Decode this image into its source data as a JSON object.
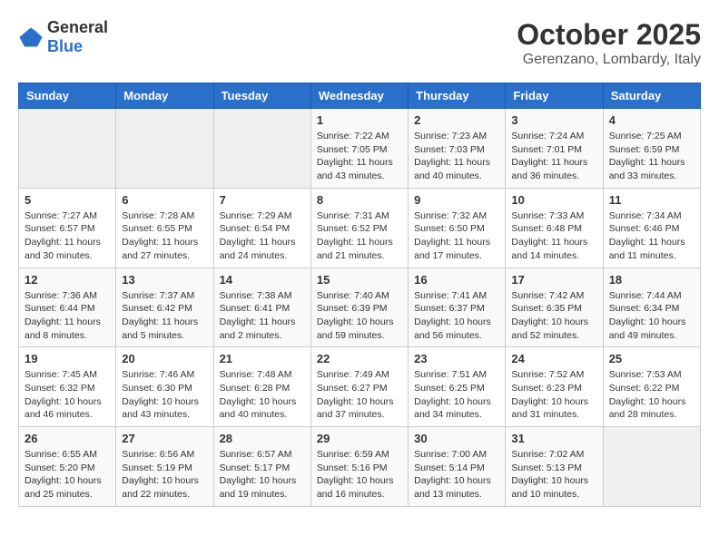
{
  "logo": {
    "general": "General",
    "blue": "Blue"
  },
  "header": {
    "month": "October 2025",
    "location": "Gerenzano, Lombardy, Italy"
  },
  "weekdays": [
    "Sunday",
    "Monday",
    "Tuesday",
    "Wednesday",
    "Thursday",
    "Friday",
    "Saturday"
  ],
  "weeks": [
    [
      {
        "day": "",
        "info": ""
      },
      {
        "day": "",
        "info": ""
      },
      {
        "day": "",
        "info": ""
      },
      {
        "day": "1",
        "info": "Sunrise: 7:22 AM\nSunset: 7:05 PM\nDaylight: 11 hours and 43 minutes."
      },
      {
        "day": "2",
        "info": "Sunrise: 7:23 AM\nSunset: 7:03 PM\nDaylight: 11 hours and 40 minutes."
      },
      {
        "day": "3",
        "info": "Sunrise: 7:24 AM\nSunset: 7:01 PM\nDaylight: 11 hours and 36 minutes."
      },
      {
        "day": "4",
        "info": "Sunrise: 7:25 AM\nSunset: 6:59 PM\nDaylight: 11 hours and 33 minutes."
      }
    ],
    [
      {
        "day": "5",
        "info": "Sunrise: 7:27 AM\nSunset: 6:57 PM\nDaylight: 11 hours and 30 minutes."
      },
      {
        "day": "6",
        "info": "Sunrise: 7:28 AM\nSunset: 6:55 PM\nDaylight: 11 hours and 27 minutes."
      },
      {
        "day": "7",
        "info": "Sunrise: 7:29 AM\nSunset: 6:54 PM\nDaylight: 11 hours and 24 minutes."
      },
      {
        "day": "8",
        "info": "Sunrise: 7:31 AM\nSunset: 6:52 PM\nDaylight: 11 hours and 21 minutes."
      },
      {
        "day": "9",
        "info": "Sunrise: 7:32 AM\nSunset: 6:50 PM\nDaylight: 11 hours and 17 minutes."
      },
      {
        "day": "10",
        "info": "Sunrise: 7:33 AM\nSunset: 6:48 PM\nDaylight: 11 hours and 14 minutes."
      },
      {
        "day": "11",
        "info": "Sunrise: 7:34 AM\nSunset: 6:46 PM\nDaylight: 11 hours and 11 minutes."
      }
    ],
    [
      {
        "day": "12",
        "info": "Sunrise: 7:36 AM\nSunset: 6:44 PM\nDaylight: 11 hours and 8 minutes."
      },
      {
        "day": "13",
        "info": "Sunrise: 7:37 AM\nSunset: 6:42 PM\nDaylight: 11 hours and 5 minutes."
      },
      {
        "day": "14",
        "info": "Sunrise: 7:38 AM\nSunset: 6:41 PM\nDaylight: 11 hours and 2 minutes."
      },
      {
        "day": "15",
        "info": "Sunrise: 7:40 AM\nSunset: 6:39 PM\nDaylight: 10 hours and 59 minutes."
      },
      {
        "day": "16",
        "info": "Sunrise: 7:41 AM\nSunset: 6:37 PM\nDaylight: 10 hours and 56 minutes."
      },
      {
        "day": "17",
        "info": "Sunrise: 7:42 AM\nSunset: 6:35 PM\nDaylight: 10 hours and 52 minutes."
      },
      {
        "day": "18",
        "info": "Sunrise: 7:44 AM\nSunset: 6:34 PM\nDaylight: 10 hours and 49 minutes."
      }
    ],
    [
      {
        "day": "19",
        "info": "Sunrise: 7:45 AM\nSunset: 6:32 PM\nDaylight: 10 hours and 46 minutes."
      },
      {
        "day": "20",
        "info": "Sunrise: 7:46 AM\nSunset: 6:30 PM\nDaylight: 10 hours and 43 minutes."
      },
      {
        "day": "21",
        "info": "Sunrise: 7:48 AM\nSunset: 6:28 PM\nDaylight: 10 hours and 40 minutes."
      },
      {
        "day": "22",
        "info": "Sunrise: 7:49 AM\nSunset: 6:27 PM\nDaylight: 10 hours and 37 minutes."
      },
      {
        "day": "23",
        "info": "Sunrise: 7:51 AM\nSunset: 6:25 PM\nDaylight: 10 hours and 34 minutes."
      },
      {
        "day": "24",
        "info": "Sunrise: 7:52 AM\nSunset: 6:23 PM\nDaylight: 10 hours and 31 minutes."
      },
      {
        "day": "25",
        "info": "Sunrise: 7:53 AM\nSunset: 6:22 PM\nDaylight: 10 hours and 28 minutes."
      }
    ],
    [
      {
        "day": "26",
        "info": "Sunrise: 6:55 AM\nSunset: 5:20 PM\nDaylight: 10 hours and 25 minutes."
      },
      {
        "day": "27",
        "info": "Sunrise: 6:56 AM\nSunset: 5:19 PM\nDaylight: 10 hours and 22 minutes."
      },
      {
        "day": "28",
        "info": "Sunrise: 6:57 AM\nSunset: 5:17 PM\nDaylight: 10 hours and 19 minutes."
      },
      {
        "day": "29",
        "info": "Sunrise: 6:59 AM\nSunset: 5:16 PM\nDaylight: 10 hours and 16 minutes."
      },
      {
        "day": "30",
        "info": "Sunrise: 7:00 AM\nSunset: 5:14 PM\nDaylight: 10 hours and 13 minutes."
      },
      {
        "day": "31",
        "info": "Sunrise: 7:02 AM\nSunset: 5:13 PM\nDaylight: 10 hours and 10 minutes."
      },
      {
        "day": "",
        "info": ""
      }
    ]
  ]
}
